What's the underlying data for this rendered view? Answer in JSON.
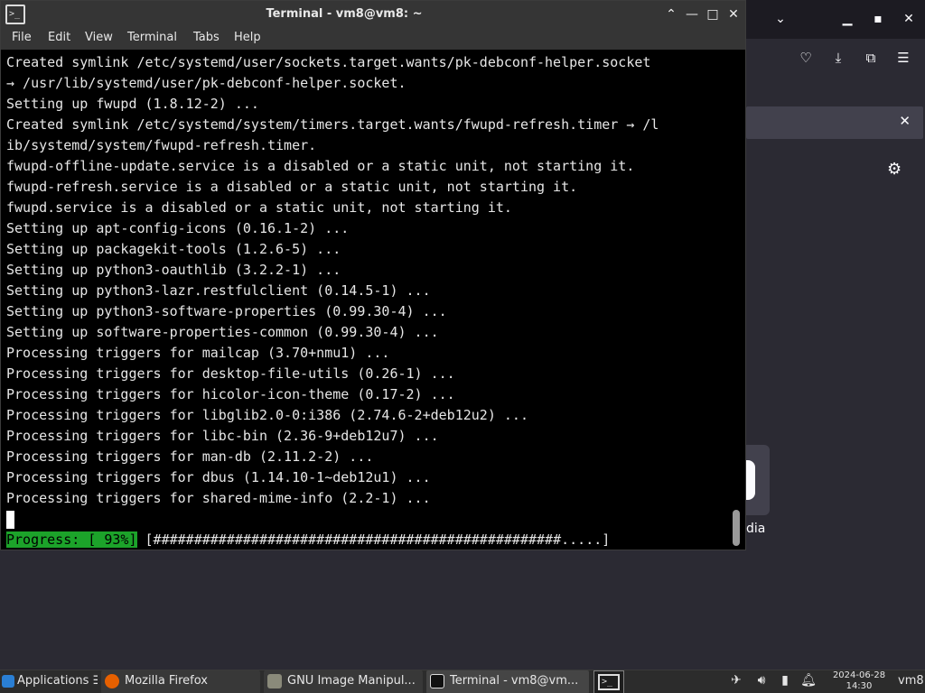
{
  "terminal": {
    "title": "Terminal - vm8@vm8: ~",
    "window_controls": {
      "shade": "⌃",
      "minimize": "—",
      "maximize": "□",
      "close": "✕"
    },
    "menu": [
      "File",
      "Edit",
      "View",
      "Terminal",
      "Tabs",
      "Help"
    ],
    "lines": [
      "Created symlink /etc/systemd/user/sockets.target.wants/pk-debconf-helper.socket",
      "→ /usr/lib/systemd/user/pk-debconf-helper.socket.",
      "Setting up fwupd (1.8.12-2) ...",
      "Created symlink /etc/systemd/system/timers.target.wants/fwupd-refresh.timer → /l",
      "ib/systemd/system/fwupd-refresh.timer.",
      "fwupd-offline-update.service is a disabled or a static unit, not starting it.",
      "fwupd-refresh.service is a disabled or a static unit, not starting it.",
      "fwupd.service is a disabled or a static unit, not starting it.",
      "Setting up apt-config-icons (0.16.1-2) ...",
      "Setting up packagekit-tools (1.2.6-5) ...",
      "Setting up python3-oauthlib (3.2.2-1) ...",
      "Setting up python3-lazr.restfulclient (0.14.5-1) ...",
      "Setting up python3-software-properties (0.99.30-4) ...",
      "Setting up software-properties-common (0.99.30-4) ...",
      "Processing triggers for mailcap (3.70+nmu1) ...",
      "Processing triggers for desktop-file-utils (0.26-1) ...",
      "Processing triggers for hicolor-icon-theme (0.17-2) ...",
      "Processing triggers for libglib2.0-0:i386 (2.74.6-2+deb12u2) ...",
      "Processing triggers for libc-bin (2.36-9+deb12u7) ...",
      "Processing triggers for man-db (2.11.2-2) ...",
      "Processing triggers for dbus (1.14.10-1~deb12u1) ...",
      "Processing triggers for shared-mime-info (2.2-1) ..."
    ],
    "progress": {
      "label": "Progress: [ 93%]",
      "bar": " [##################################################.....]",
      "percent": 93
    }
  },
  "firefox_background": {
    "notification_close": "✕",
    "tile_label": "dia"
  },
  "taskbar": {
    "applications": "Applications",
    "applications_suffix": "☰",
    "tasks": [
      {
        "label": "Mozilla Firefox",
        "icon": "firefox-icon"
      },
      {
        "label": "GNU Image Manipul...",
        "icon": "gimp-icon"
      },
      {
        "label": "Terminal - vm8@vm...",
        "icon": "terminal-icon"
      }
    ],
    "clock_date": "2024-06-28",
    "clock_time": "14:30",
    "user": "vm8"
  },
  "colors": {
    "progress_green": "#1ca32a",
    "terminal_bg": "#000000",
    "titlebar": "#353535"
  }
}
